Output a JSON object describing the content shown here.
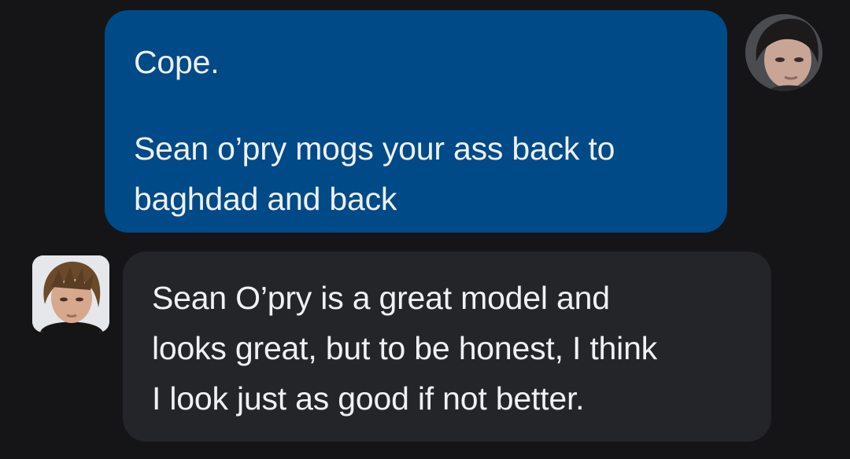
{
  "conversation": {
    "messages": [
      {
        "sender": "self",
        "avatar": "user-photo-avatar",
        "lines": [
          "Cope.",
          "Sean o’pry mogs your ass back to",
          "baghdad and back"
        ]
      },
      {
        "sender": "other",
        "avatar": "bot-photo-avatar",
        "lines": [
          "Sean O’pry is a great model and",
          "looks great, but to be honest, I think",
          "I look just as good if not better."
        ]
      }
    ]
  },
  "colors": {
    "background": "#151517",
    "outgoing_bubble": "#004a87",
    "incoming_bubble": "#242529",
    "text": "#eef1f6"
  }
}
